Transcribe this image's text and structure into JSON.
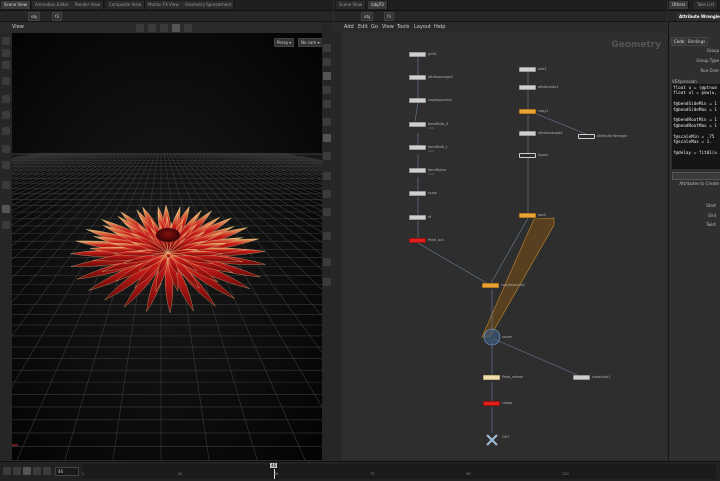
{
  "tabs_left": [
    "Scene View",
    "Animation Editor",
    "Render View",
    "Composite View",
    "Motion FX View",
    "Geometry Spreadsheet"
  ],
  "tabs_mid": [
    "Scene View",
    "/obj/f3"
  ],
  "tabs_right": [
    "Others",
    "Take List"
  ],
  "path": {
    "obj": "obj",
    "node": "f3"
  },
  "viewport": {
    "title": "View",
    "persp": "Persp ▾",
    "cam": "No cam ▾"
  },
  "menu": [
    "Add",
    "Edit",
    "Go",
    "View",
    "Tools",
    "Layout",
    "Help"
  ],
  "network_watermark": "Geometry",
  "nodes": [
    {
      "id": "n1",
      "label": "grid1",
      "sub": "",
      "style": "light"
    },
    {
      "id": "n2",
      "label": "attribwrangle2",
      "sub": "",
      "style": "light"
    },
    {
      "id": "n3",
      "label": "copytopoints1",
      "sub": "",
      "style": "light"
    },
    {
      "id": "n4",
      "label": "bendBulb_G",
      "sub": "amt",
      "style": "light"
    },
    {
      "id": "n5",
      "label": "bendBulb_L",
      "sub": "amt",
      "style": "light"
    },
    {
      "id": "n6",
      "label": "bendNoise",
      "sub": "amt",
      "style": "light"
    },
    {
      "id": "n7",
      "label": "scale",
      "sub": "",
      "style": "light"
    },
    {
      "id": "n8",
      "label": "xf",
      "sub": "",
      "style": "light"
    },
    {
      "id": "n9",
      "label": "Petal_out",
      "sub": "",
      "style": "red"
    },
    {
      "id": "n10",
      "label": "add1",
      "sub": "",
      "style": "light"
    },
    {
      "id": "n11",
      "label": "attribnoise1",
      "sub": "",
      "style": "light"
    },
    {
      "id": "n12",
      "label": "copy1",
      "sub": "",
      "style": "orange"
    },
    {
      "id": "n13",
      "label": "attribwrangle1",
      "sub": "",
      "style": "light"
    },
    {
      "id": "n14",
      "label": "Attribute Wrangle",
      "sub": "",
      "style": "dark"
    },
    {
      "id": "n15",
      "label": "layers",
      "sub": "",
      "style": "dark"
    },
    {
      "id": "n16",
      "label": "pack",
      "sub": "",
      "style": "orange"
    },
    {
      "id": "n17",
      "label": "copytopoints1",
      "sub": "",
      "style": "orange"
    },
    {
      "id": "n18",
      "label": "solver",
      "sub": "",
      "style": "dark"
    },
    {
      "id": "n19",
      "label": "Petal_reform",
      "sub": "",
      "style": "cream"
    },
    {
      "id": "n20",
      "label": "subdivide1",
      "sub": "",
      "style": "light"
    },
    {
      "id": "n21",
      "label": "clamp",
      "sub": "",
      "style": "red"
    },
    {
      "id": "n22",
      "label": "OUT",
      "sub": "",
      "style": "light"
    }
  ],
  "params": {
    "node_title": "Attribute Wrangle",
    "tabs": [
      "Code",
      "Bindings"
    ],
    "group": "Group",
    "group_type": "Group Type",
    "run_over": "Run Over",
    "vex_label": "VEXpression",
    "code_lines": [
      "float u = (@ptnum",
      "float ul = pow(u,",
      "",
      "f@bendSideMin = 1",
      "f@bendSideMax = 1",
      "",
      "f@bendRootMin = 1",
      "f@bendRootMax = 1",
      "",
      "f@scaleMin = .75",
      "f@scaleMax = 1.",
      "",
      "f@delay = fit01(u"
    ],
    "attrib_create": "Attributes to Create",
    "start": "Start",
    "end": "End",
    "twist": "Twist"
  },
  "timeline": {
    "frame": "46",
    "ticks": [
      "1",
      "24",
      "48",
      "72",
      "96",
      "120"
    ],
    "playhead_frame": "46",
    "marker": "46"
  },
  "colors": {
    "accent": "#e8a436",
    "flower": "#c4181a",
    "red_node": "#e0201c"
  }
}
